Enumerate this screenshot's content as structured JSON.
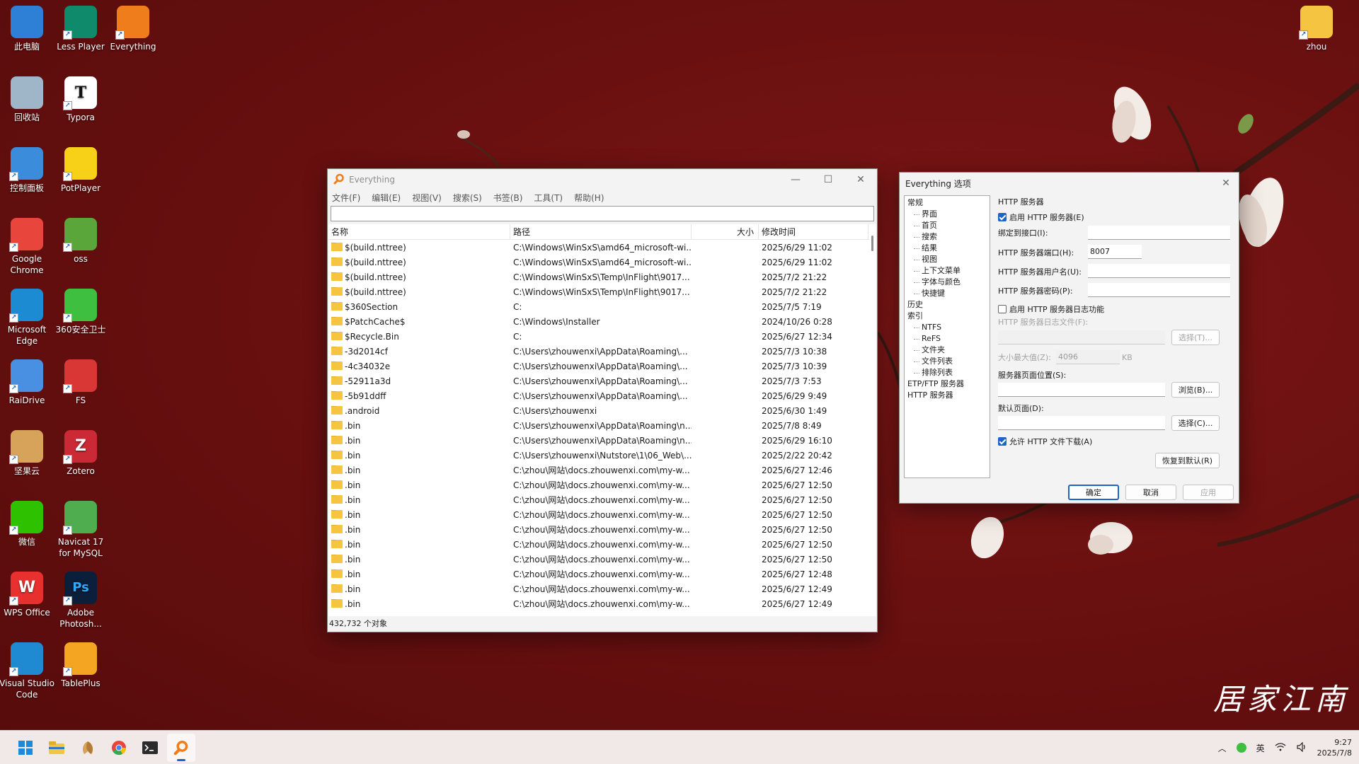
{
  "desktop": {
    "icons": [
      {
        "label": "此电脑",
        "icon": "computer-icon",
        "color": "#2e7fd6"
      },
      {
        "label": "Less Player",
        "icon": "less-player-icon",
        "color": "#0f8a6a"
      },
      {
        "label": "Everything",
        "icon": "everything-icon",
        "color": "#f07d1b"
      },
      {
        "label": "回收站",
        "icon": "recycle-bin-icon",
        "color": "#9fb6c8"
      },
      {
        "label": "Typora",
        "icon": "typora-icon",
        "color": "#ffffff"
      },
      {
        "label": "控制面板",
        "icon": "control-panel-icon",
        "color": "#3b8ddb"
      },
      {
        "label": "PotPlayer",
        "icon": "potplayer-icon",
        "color": "#f7d117"
      },
      {
        "label": "Google Chrome",
        "icon": "chrome-icon",
        "color": "#e8453c"
      },
      {
        "label": "oss",
        "icon": "oss-icon",
        "color": "#5aa63a"
      },
      {
        "label": "Microsoft Edge",
        "icon": "edge-icon",
        "color": "#1d8bd1"
      },
      {
        "label": "360安全卫士",
        "icon": "360-icon",
        "color": "#3fbf3f"
      },
      {
        "label": "RaiDrive",
        "icon": "raidrive-icon",
        "color": "#4a90e2"
      },
      {
        "label": "FS",
        "icon": "fs-icon",
        "color": "#d93636"
      },
      {
        "label": "坚果云",
        "icon": "jianguoyun-icon",
        "color": "#d7a35a"
      },
      {
        "label": "Zotero",
        "icon": "zotero-icon",
        "color": "#cc2936"
      },
      {
        "label": "微信",
        "icon": "wechat-icon",
        "color": "#2dc100"
      },
      {
        "label": "Navicat 17 for MySQL",
        "icon": "navicat-icon",
        "color": "#4fad4f"
      },
      {
        "label": "WPS Office",
        "icon": "wps-icon",
        "color": "#e8312e"
      },
      {
        "label": "Adobe Photosh...",
        "icon": "photoshop-icon",
        "color": "#0b1f3a"
      },
      {
        "label": "Visual Studio Code",
        "icon": "vscode-icon",
        "color": "#1f8ad2"
      },
      {
        "label": "TablePlus",
        "icon": "tableplus-icon",
        "color": "#f4a623"
      },
      {
        "label": "zhou",
        "icon": "user-folder-icon",
        "color": "#f5c542"
      }
    ],
    "watermark": "居家江南"
  },
  "everything": {
    "title": "Everything",
    "menu": [
      "文件(F)",
      "编辑(E)",
      "视图(V)",
      "搜索(S)",
      "书签(B)",
      "工具(T)",
      "帮助(H)"
    ],
    "search_value": "",
    "columns": {
      "name": "名称",
      "path": "路径",
      "size": "大小",
      "date": "修改时间"
    },
    "rows": [
      {
        "name": "$(build.nttree)",
        "path": "C:\\Windows\\WinSxS\\amd64_microsoft-wi...",
        "size": "",
        "date": "2025/6/29 11:02"
      },
      {
        "name": "$(build.nttree)",
        "path": "C:\\Windows\\WinSxS\\amd64_microsoft-wi...",
        "size": "",
        "date": "2025/6/29 11:02"
      },
      {
        "name": "$(build.nttree)",
        "path": "C:\\Windows\\WinSxS\\Temp\\InFlight\\9017...",
        "size": "",
        "date": "2025/7/2 21:22"
      },
      {
        "name": "$(build.nttree)",
        "path": "C:\\Windows\\WinSxS\\Temp\\InFlight\\9017...",
        "size": "",
        "date": "2025/7/2 21:22"
      },
      {
        "name": "$360Section",
        "path": "C:",
        "size": "",
        "date": "2025/7/5 7:19"
      },
      {
        "name": "$PatchCache$",
        "path": "C:\\Windows\\Installer",
        "size": "",
        "date": "2024/10/26 0:28"
      },
      {
        "name": "$Recycle.Bin",
        "path": "C:",
        "size": "",
        "date": "2025/6/27 12:34"
      },
      {
        "name": "-3d2014cf",
        "path": "C:\\Users\\zhouwenxi\\AppData\\Roaming\\...",
        "size": "",
        "date": "2025/7/3 10:38"
      },
      {
        "name": "-4c34032e",
        "path": "C:\\Users\\zhouwenxi\\AppData\\Roaming\\...",
        "size": "",
        "date": "2025/7/3 10:39"
      },
      {
        "name": "-52911a3d",
        "path": "C:\\Users\\zhouwenxi\\AppData\\Roaming\\...",
        "size": "",
        "date": "2025/7/3 7:53"
      },
      {
        "name": "-5b91ddff",
        "path": "C:\\Users\\zhouwenxi\\AppData\\Roaming\\...",
        "size": "",
        "date": "2025/6/29 9:49"
      },
      {
        "name": ".android",
        "path": "C:\\Users\\zhouwenxi",
        "size": "",
        "date": "2025/6/30 1:49"
      },
      {
        "name": ".bin",
        "path": "C:\\Users\\zhouwenxi\\AppData\\Roaming\\n...",
        "size": "",
        "date": "2025/7/8 8:49"
      },
      {
        "name": ".bin",
        "path": "C:\\Users\\zhouwenxi\\AppData\\Roaming\\n...",
        "size": "",
        "date": "2025/6/29 16:10"
      },
      {
        "name": ".bin",
        "path": "C:\\Users\\zhouwenxi\\Nutstore\\1\\06_Web\\...",
        "size": "",
        "date": "2025/2/22 20:42"
      },
      {
        "name": ".bin",
        "path": "C:\\zhou\\网站\\docs.zhouwenxi.com\\my-w...",
        "size": "",
        "date": "2025/6/27 12:46"
      },
      {
        "name": ".bin",
        "path": "C:\\zhou\\网站\\docs.zhouwenxi.com\\my-w...",
        "size": "",
        "date": "2025/6/27 12:50"
      },
      {
        "name": ".bin",
        "path": "C:\\zhou\\网站\\docs.zhouwenxi.com\\my-w...",
        "size": "",
        "date": "2025/6/27 12:50"
      },
      {
        "name": ".bin",
        "path": "C:\\zhou\\网站\\docs.zhouwenxi.com\\my-w...",
        "size": "",
        "date": "2025/6/27 12:50"
      },
      {
        "name": ".bin",
        "path": "C:\\zhou\\网站\\docs.zhouwenxi.com\\my-w...",
        "size": "",
        "date": "2025/6/27 12:50"
      },
      {
        "name": ".bin",
        "path": "C:\\zhou\\网站\\docs.zhouwenxi.com\\my-w...",
        "size": "",
        "date": "2025/6/27 12:50"
      },
      {
        "name": ".bin",
        "path": "C:\\zhou\\网站\\docs.zhouwenxi.com\\my-w...",
        "size": "",
        "date": "2025/6/27 12:50"
      },
      {
        "name": ".bin",
        "path": "C:\\zhou\\网站\\docs.zhouwenxi.com\\my-w...",
        "size": "",
        "date": "2025/6/27 12:48"
      },
      {
        "name": ".bin",
        "path": "C:\\zhou\\网站\\docs.zhouwenxi.com\\my-w...",
        "size": "",
        "date": "2025/6/27 12:49"
      },
      {
        "name": ".bin",
        "path": "C:\\zhou\\网站\\docs.zhouwenxi.com\\my-w...",
        "size": "",
        "date": "2025/6/27 12:49"
      }
    ],
    "status": "432,732 个对象"
  },
  "options": {
    "title": "Everything 选项",
    "tree": {
      "general": "常规",
      "general_children": [
        "界面",
        "首页",
        "搜索",
        "结果",
        "视图",
        "上下文菜单",
        "字体与颜色",
        "快捷键"
      ],
      "history": "历史",
      "index": "索引",
      "index_children": [
        "NTFS",
        "ReFS",
        "文件夹",
        "文件列表",
        "排除列表"
      ],
      "etp": "ETP/FTP 服务器",
      "http": "HTTP 服务器"
    },
    "panel": {
      "heading": "HTTP 服务器",
      "enable_label": "启用 HTTP 服务器(E)",
      "enable_checked": true,
      "bind_label": "绑定到接口(I):",
      "bind_value": "",
      "port_label": "HTTP 服务器端口(H):",
      "port_value": "8007",
      "user_label": "HTTP 服务器用户名(U):",
      "user_value": "",
      "pass_label": "HTTP 服务器密码(P):",
      "pass_value": "",
      "log_label": "启用 HTTP 服务器日志功能",
      "log_checked": false,
      "logfile_label": "HTTP 服务器日志文件(F):",
      "logfile_value": "",
      "select_t": "选择(T)...",
      "maxsize_label": "大小最大值(Z):",
      "maxsize_value": "4096",
      "maxsize_unit": "KB",
      "pageloc_label": "服务器页面位置(S):",
      "pageloc_value": "",
      "browse": "浏览(B)...",
      "defpage_label": "默认页面(D):",
      "defpage_value": "",
      "select_c": "选择(C)...",
      "allow_label": "允许 HTTP 文件下载(A)",
      "allow_checked": true,
      "restore": "恢复到默认(R)"
    },
    "buttons": {
      "ok": "确定",
      "cancel": "取消",
      "apply": "应用"
    }
  },
  "taskbar": {
    "apps": [
      "start-icon",
      "file-explorer-icon",
      "jianguoyun-icon",
      "chrome-icon",
      "terminal-icon",
      "everything-icon"
    ],
    "ime": "英",
    "time": "9:27",
    "date": "2025/7/8"
  }
}
